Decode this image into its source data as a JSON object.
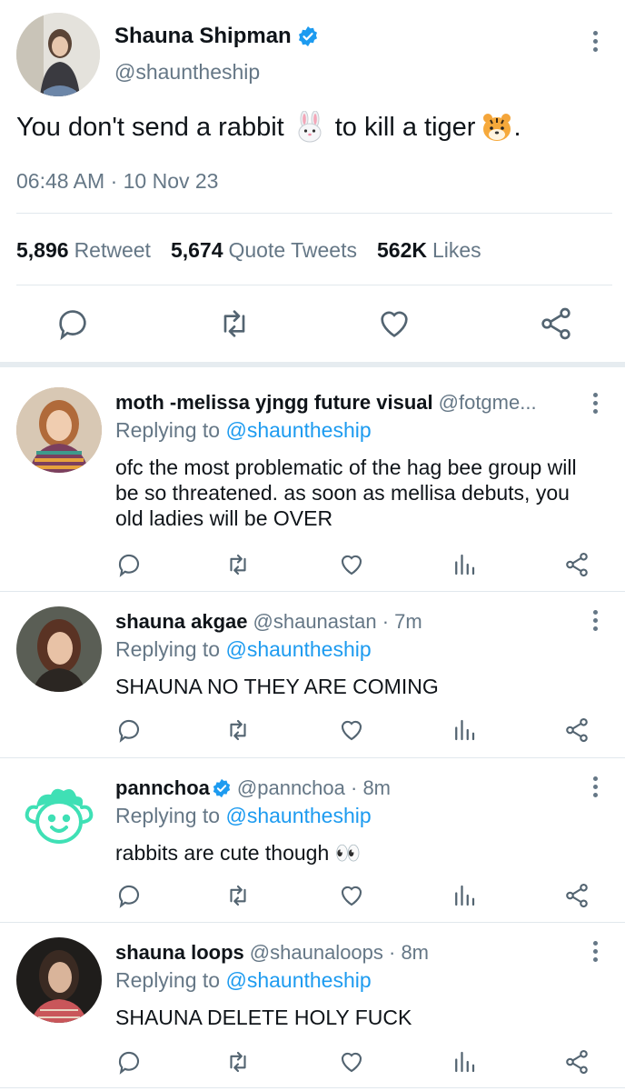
{
  "main_tweet": {
    "name": "Shauna Shipman",
    "handle": "@shauntheship",
    "text_part1": "You don't send a rabbit",
    "text_part2": "to kill a tiger",
    "text_end": ".",
    "emoji1": "rabbit-face",
    "emoji2": "tiger-face",
    "time": "06:48 AM · 10 Nov 23",
    "stats": [
      {
        "count": "5,896",
        "label": "Retweet"
      },
      {
        "count": "5,674",
        "label": "Quote Tweets"
      },
      {
        "count": "562K",
        "label": "Likes"
      }
    ],
    "actions": [
      "reply-icon",
      "retweet-icon",
      "like-icon",
      "share-icon"
    ]
  },
  "replies": [
    {
      "name": "moth -melissa yjngg future visual",
      "handle": "@fotgme...",
      "time": "",
      "replying_prefix": "Replying to",
      "replying_to": "@shauntheship",
      "text": "ofc the most problematic of the hag bee group will be so threatened. as soon as mellisa debuts, you old ladies will be OVER"
    },
    {
      "name": "shauna akgae",
      "handle": "@shaunastan · 7m",
      "replying_prefix": "Replying to",
      "replying_to": "@shauntheship",
      "text": "SHAUNA NO THEY ARE COMING"
    },
    {
      "name": "pannchoa",
      "handle": "@pannchoa · 8m",
      "replying_prefix": "Replying to",
      "replying_to": "@shauntheship",
      "text": "rabbits are cute though 👀"
    },
    {
      "name": "shauna loops",
      "handle": "@shaunaloops · 8m",
      "replying_prefix": "Replying to",
      "replying_to": "@shauntheship",
      "text": "SHAUNA DELETE HOLY FUCK"
    }
  ],
  "colors": {
    "accent": "#1d9bf0",
    "muted": "#657786",
    "icon": "#536471",
    "verified": "#1d9bf0",
    "pannchoa_logo": "#3fe0b5"
  }
}
